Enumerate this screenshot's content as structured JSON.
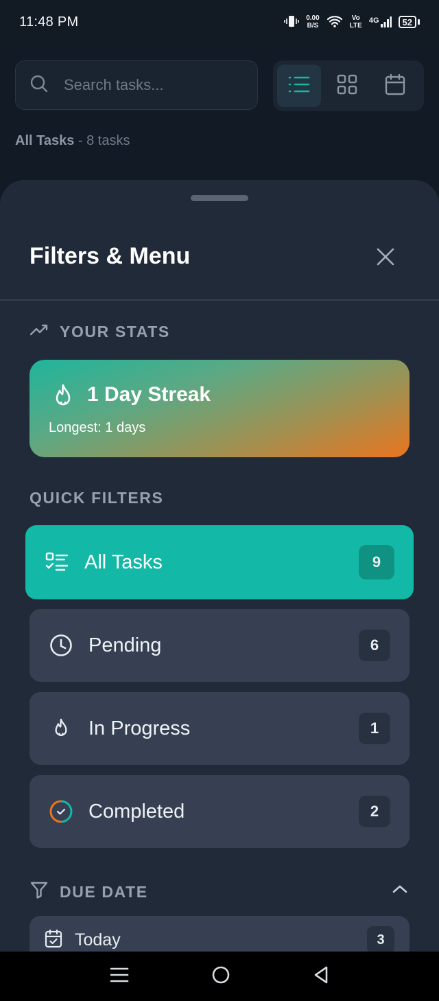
{
  "status_bar": {
    "time": "11:48 PM",
    "net_speed_value": "0.00",
    "net_speed_unit": "B/S",
    "volte_top": "Vo",
    "volte_bottom": "LTE",
    "network": "4G",
    "battery": "52"
  },
  "background": {
    "search_placeholder": "Search tasks...",
    "heading": "All Tasks",
    "separator": " - ",
    "task_count": "8 tasks"
  },
  "sheet": {
    "title": "Filters & Menu",
    "stats_label": "YOUR STATS",
    "streak_title": "1 Day Streak",
    "streak_sub": "Longest: 1 days",
    "quick_filters_label": "QUICK FILTERS",
    "filters": [
      {
        "label": "All Tasks",
        "count": "9"
      },
      {
        "label": "Pending",
        "count": "6"
      },
      {
        "label": "In Progress",
        "count": "1"
      },
      {
        "label": "Completed",
        "count": "2"
      }
    ],
    "due_date_label": "DUE DATE",
    "due_items": [
      {
        "label": "Today",
        "count": "3"
      }
    ]
  },
  "colors": {
    "accent": "#14b8a6",
    "sheet_bg": "#212a38",
    "filter_bg": "#364052",
    "streak_start": "#1fb59c",
    "streak_end": "#e9751f"
  }
}
